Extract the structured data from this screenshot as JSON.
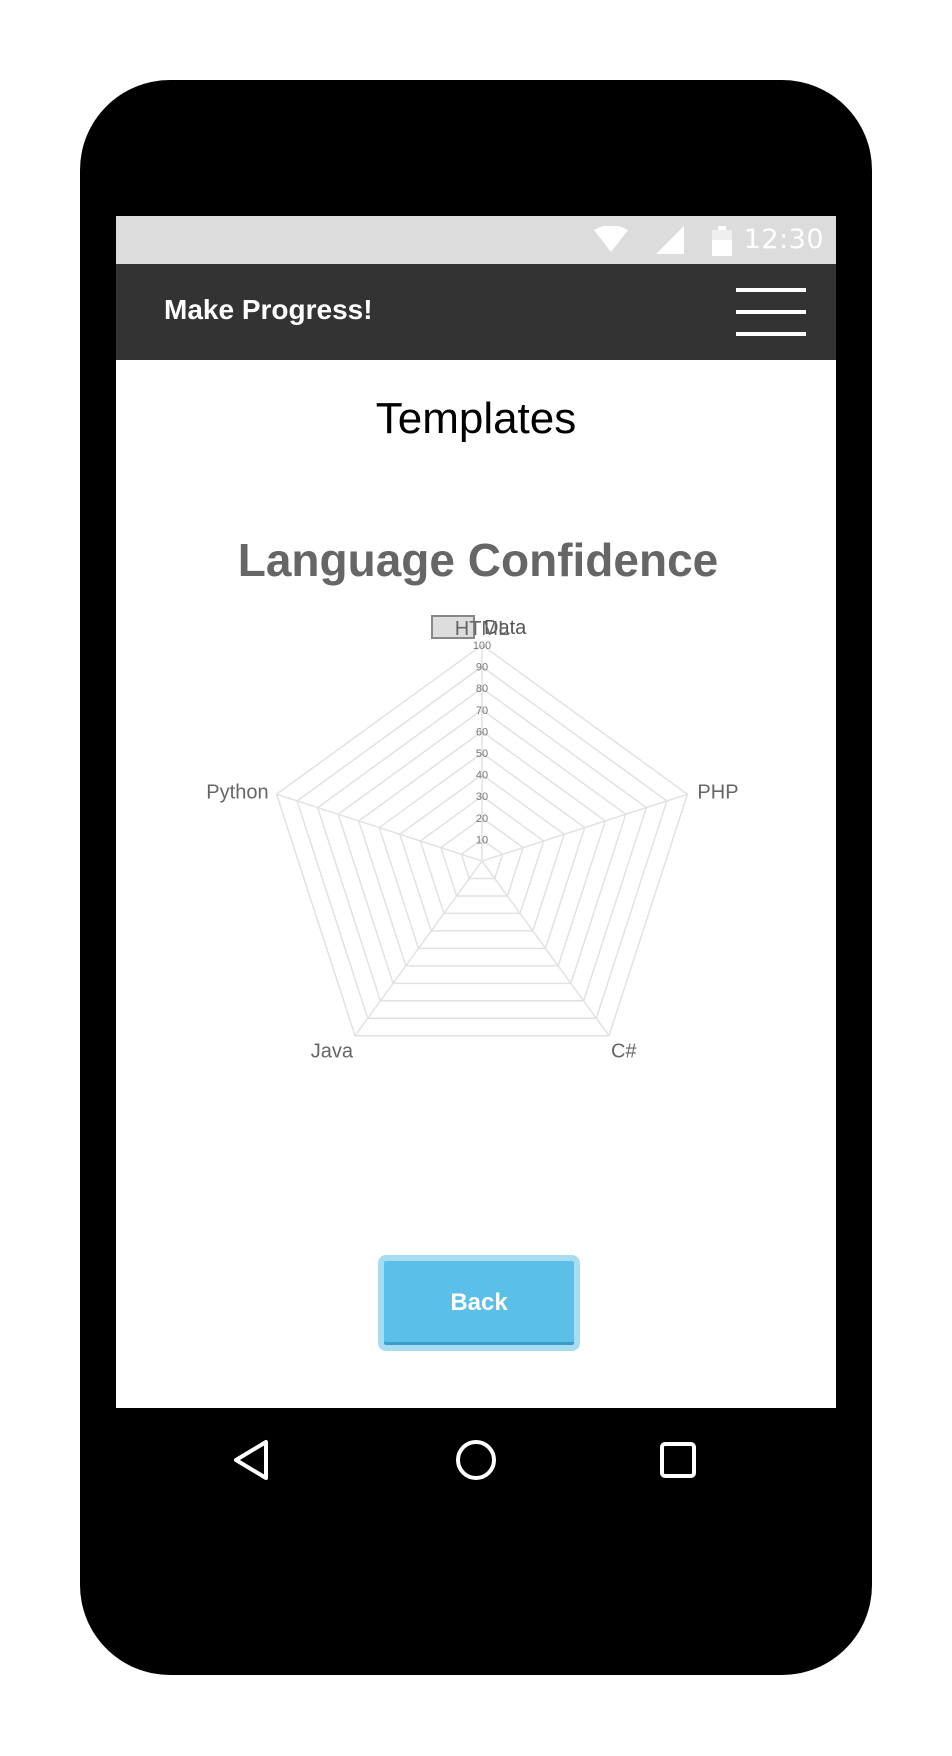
{
  "status_bar": {
    "time": "12:30",
    "icons": [
      "wifi-icon",
      "signal-icon",
      "battery-icon"
    ]
  },
  "app_bar": {
    "title": "Make Progress!",
    "menu_icon": "hamburger-menu-icon"
  },
  "page": {
    "heading": "Templates"
  },
  "chart_data": {
    "type": "radar",
    "title": "Language Confidence",
    "legend": [
      "Data"
    ],
    "legend_position": "top",
    "categories": [
      "HTML",
      "PHP",
      "C#",
      "Java",
      "Python"
    ],
    "series": [
      {
        "name": "Data",
        "values": [
          0,
          0,
          0,
          0,
          0
        ]
      }
    ],
    "rlim": [
      0,
      100
    ],
    "ticks": [
      "10",
      "20",
      "30",
      "40",
      "50",
      "60",
      "70",
      "80",
      "90",
      "100"
    ],
    "grid": true,
    "colors": {
      "title": "#666666",
      "grid": "#e2e2e2",
      "labels": "#666666",
      "legend_fill": "#dddddd",
      "legend_stroke": "#888888"
    }
  },
  "actions": {
    "back_label": "Back"
  },
  "nav_bar": {
    "back_icon": "triangle-back-icon",
    "home_icon": "circle-home-icon",
    "recents_icon": "square-recents-icon"
  }
}
